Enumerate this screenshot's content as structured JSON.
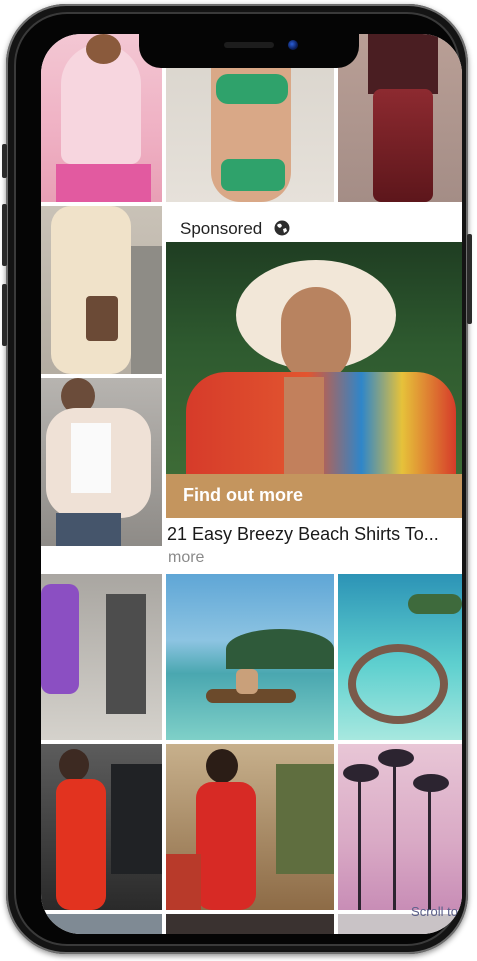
{
  "ad": {
    "sponsored_label": "Sponsored",
    "cta_label": "Find out more",
    "title": "21 Easy Breezy Beach Shirts To...",
    "more_label": "more"
  },
  "overlay_text": "Scroll to",
  "icons": {
    "globe": "globe-icon"
  },
  "colors": {
    "cta_background": "#c4955e",
    "title_text": "#1a1a1a",
    "more_text": "#8a8a8a"
  }
}
